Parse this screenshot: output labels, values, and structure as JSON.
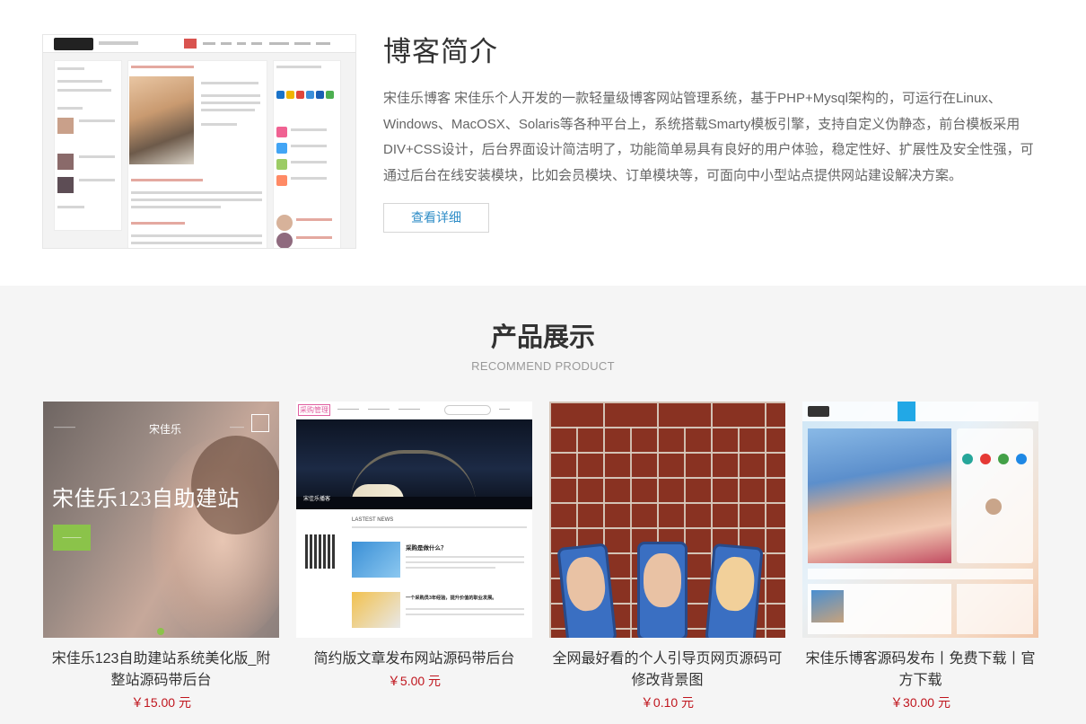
{
  "intro": {
    "title": "博客简介",
    "description": "宋佳乐博客 宋佳乐个人开发的一款轻量级博客网站管理系统，基于PHP+Mysql架构的，可运行在Linux、Windows、MacOSX、Solaris等各种平台上，系统搭载Smarty模板引擎，支持自定义伪静态，前台模板采用DIV+CSS设计，后台界面设计简洁明了，功能简单易具有良好的用户体验，稳定性好、扩展性及安全性强，可通过后台在线安装模块，比如会员模块、订单模块等，可面向中小型站点提供网站建设解决方案。",
    "detail_button": "查看详细"
  },
  "products": {
    "title": "产品展示",
    "subtitle": "RECOMMEND PRODUCT",
    "items": [
      {
        "name": "宋佳乐123自助建站系统美化版_附整站源码带后台",
        "price": "￥15.00 元",
        "image_brand": "宋佳乐",
        "image_headline": "宋佳乐123自助建站"
      },
      {
        "name": "简约版文章发布网站源码带后台",
        "price": "￥5.00 元",
        "image_logo": "采购管理",
        "image_caption": "宋佳乐播客",
        "image_section": "LASTEST NEWS",
        "image_news_1": "采购是做什么？",
        "image_news_2": "一个采购员3年经验，提升价值的职业发展。"
      },
      {
        "name": "全网最好看的个人引导页网页源码可修改背景图",
        "price": "￥0.10 元"
      },
      {
        "name": "宋佳乐博客源码发布丨免费下载丨官方下载",
        "price": "￥30.00 元"
      }
    ]
  }
}
